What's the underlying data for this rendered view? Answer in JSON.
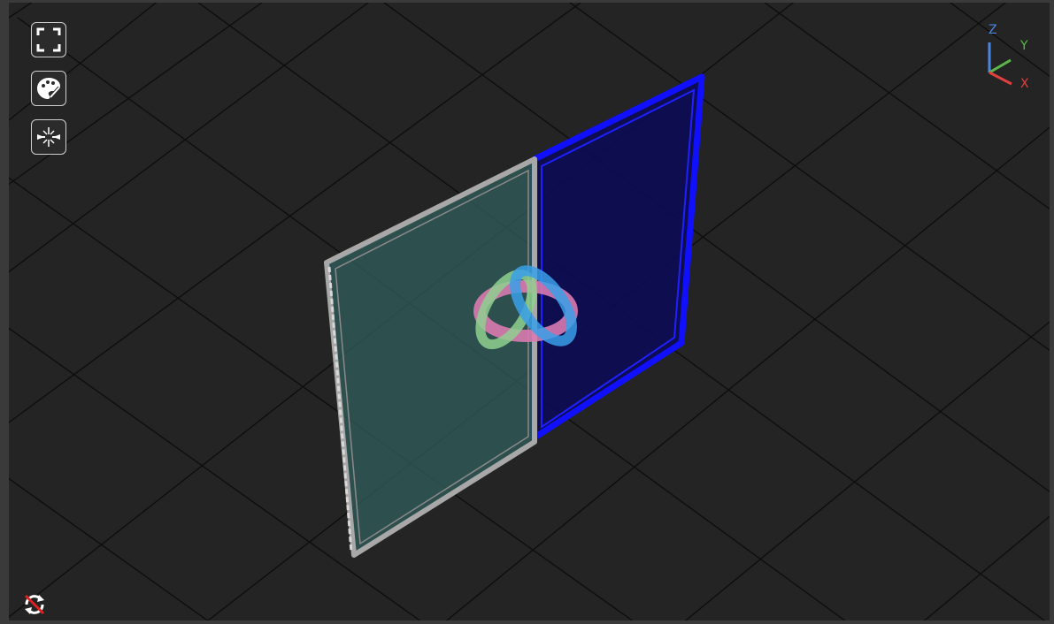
{
  "viewport": {
    "background_color": "#242424",
    "grid_color": "#111111"
  },
  "toolbar": {
    "buttons": [
      {
        "icon": "fullscreen-icon"
      },
      {
        "icon": "palette-brush-icon"
      },
      {
        "icon": "center-focus-icon"
      }
    ]
  },
  "axis_gizmo": {
    "x_label": "X",
    "y_label": "Y",
    "z_label": "Z",
    "x_color": "#e04040",
    "y_color": "#5cb84a",
    "z_color": "#4a86e0"
  },
  "model": {
    "left_panel_color": "#2f5a57",
    "left_frame_color": "#a8a8a8",
    "right_panel_color": "#0b0b55",
    "right_frame_color": "#1010ff",
    "gizmo_icon": "transform-gizmo-icon"
  },
  "status": {
    "icon": "sync-disabled-icon"
  }
}
